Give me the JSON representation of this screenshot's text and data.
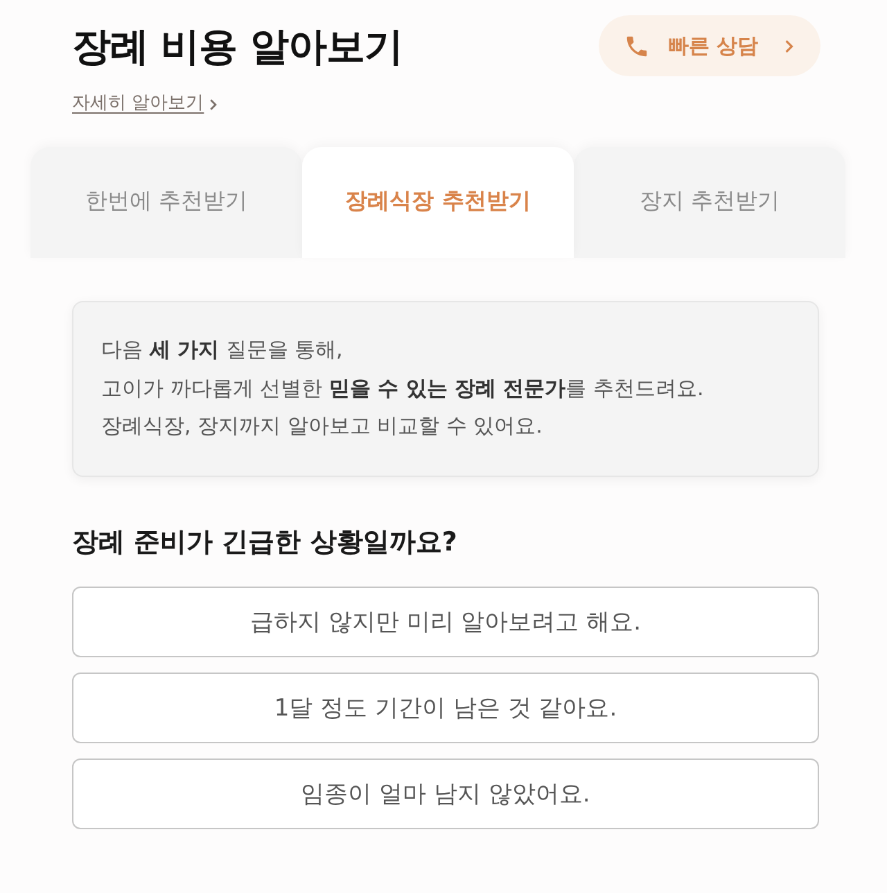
{
  "header": {
    "title": "장례 비용 알아보기",
    "consult_button": {
      "label": "빠른 상담"
    },
    "detail_link": {
      "label": "자세히 알아보기"
    }
  },
  "tabs": [
    {
      "label": "한번에 추천받기",
      "selected": false
    },
    {
      "label": "장례식장 추천받기",
      "selected": true
    },
    {
      "label": "장지 추천받기",
      "selected": false
    }
  ],
  "intro": {
    "lines": [
      "다음 **세 가지** 질문을 통해,",
      "고이가 까다롭게 선별한 **믿을 수 있는 장례 전문가**를 추천드려요.",
      "장례식장, 장지까지 알아보고 비교할 수 있어요."
    ]
  },
  "question": {
    "title": "장례 준비가 긴급한 상황일까요?",
    "options": [
      {
        "label": "급하지 않지만 미리 알아보려고 해요.",
        "selected": false
      },
      {
        "label": "1달 정도 기간이 남은 것 같아요.",
        "selected": false
      },
      {
        "label": "임종이 얼마 남지 않았어요.",
        "selected": false
      }
    ]
  }
}
